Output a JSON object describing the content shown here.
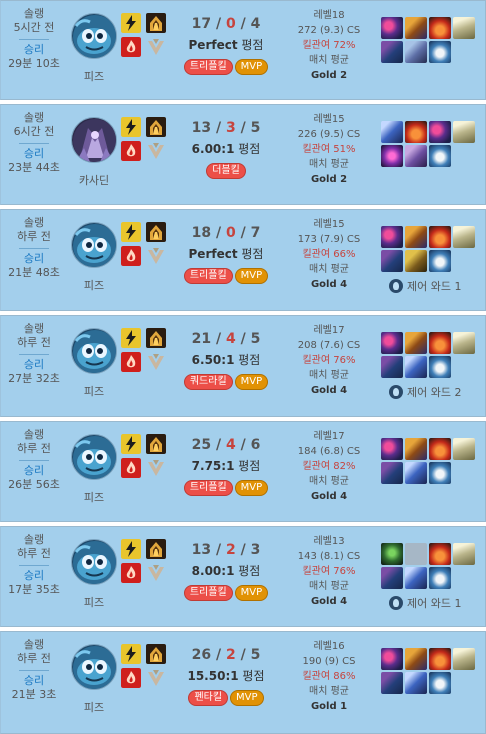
{
  "games": [
    {
      "queue": "솔랭",
      "ago": "5시간 전",
      "result": "승리",
      "duration": "29분 10초",
      "champion": "피즈",
      "champ_style": "fizz",
      "spells": [
        "flash",
        "ignite"
      ],
      "runes": [
        "precision",
        "sorcery"
      ],
      "kills": "17",
      "deaths": "0",
      "assists": "4",
      "ratio": "Perfect",
      "ratio_suffix": " 평점",
      "badges": [
        {
          "label": "트리플킬",
          "type": "kill"
        },
        {
          "label": "MVP",
          "type": "mvp"
        }
      ],
      "level": "레벨18",
      "cs": "272 (9.3) CS",
      "kp": "킬관여 72%",
      "tier": "매치 평균",
      "gold": "Gold 2",
      "items": [
        "lich",
        "zhonya",
        "rabadon",
        "hat",
        "tome",
        "boots",
        "potion"
      ],
      "ward": ""
    },
    {
      "queue": "솔랭",
      "ago": "6시간 전",
      "result": "승리",
      "duration": "23분 44초",
      "champion": "카사딘",
      "champ_style": "kassadin",
      "spells": [
        "flash",
        "ignite"
      ],
      "runes": [
        "precision",
        "sorcery"
      ],
      "kills": "13",
      "deaths": "3",
      "assists": "5",
      "ratio": "6.00:1",
      "ratio_suffix": " 평점",
      "badges": [
        {
          "label": "더블킬",
          "type": "kill"
        }
      ],
      "level": "레벨15",
      "cs": "226 (9.5) CS",
      "kp": "킬관여 51%",
      "tier": "매치 평균",
      "gold": "Gold 2",
      "items": [
        "staff",
        "rabadon",
        "lich",
        "hat",
        "void",
        "boots2",
        "potion"
      ],
      "ward": ""
    },
    {
      "queue": "솔랭",
      "ago": "하루 전",
      "result": "승리",
      "duration": "21분 48초",
      "champion": "피즈",
      "champ_style": "fizz",
      "spells": [
        "flash",
        "ignite"
      ],
      "runes": [
        "precision",
        "sorcery"
      ],
      "kills": "18",
      "deaths": "0",
      "assists": "7",
      "ratio": "Perfect",
      "ratio_suffix": " 평점",
      "badges": [
        {
          "label": "트리플킬",
          "type": "kill"
        },
        {
          "label": "MVP",
          "type": "mvp"
        }
      ],
      "level": "레벨15",
      "cs": "173 (7.9) CS",
      "kp": "킬관여 66%",
      "tier": "매치 평균",
      "gold": "Gold 4",
      "items": [
        "lich",
        "zhonya",
        "rabadon",
        "hat",
        "tome",
        "chest",
        "potion"
      ],
      "ward": "제어 와드 1"
    },
    {
      "queue": "솔랭",
      "ago": "하루 전",
      "result": "승리",
      "duration": "27분 32초",
      "champion": "피즈",
      "champ_style": "fizz",
      "spells": [
        "flash",
        "ignite"
      ],
      "runes": [
        "precision",
        "sorcery"
      ],
      "kills": "21",
      "deaths": "4",
      "assists": "5",
      "ratio": "6.50:1",
      "ratio_suffix": " 평점",
      "badges": [
        {
          "label": "쿼드라킬",
          "type": "kill"
        },
        {
          "label": "MVP",
          "type": "mvp"
        }
      ],
      "level": "레벨17",
      "cs": "208 (7.6) CS",
      "kp": "킬관여 76%",
      "tier": "매치 평균",
      "gold": "Gold 4",
      "items": [
        "lich",
        "zhonya",
        "rabadon",
        "hat",
        "tome",
        "staff",
        "potion"
      ],
      "ward": "제어 와드 2"
    },
    {
      "queue": "솔랭",
      "ago": "하루 전",
      "result": "승리",
      "duration": "26분 56초",
      "champion": "피즈",
      "champ_style": "fizz",
      "spells": [
        "flash",
        "ignite"
      ],
      "runes": [
        "precision",
        "sorcery"
      ],
      "kills": "25",
      "deaths": "4",
      "assists": "6",
      "ratio": "7.75:1",
      "ratio_suffix": " 평점",
      "badges": [
        {
          "label": "트리플킬",
          "type": "kill"
        },
        {
          "label": "MVP",
          "type": "mvp"
        }
      ],
      "level": "레벨17",
      "cs": "184 (6.8) CS",
      "kp": "킬관여 82%",
      "tier": "매치 평균",
      "gold": "Gold 4",
      "items": [
        "lich",
        "zhonya",
        "rabadon",
        "hat",
        "tome",
        "staff",
        "potion"
      ],
      "ward": ""
    },
    {
      "queue": "솔랭",
      "ago": "하루 전",
      "result": "승리",
      "duration": "17분 35초",
      "champion": "피즈",
      "champ_style": "fizz",
      "spells": [
        "flash",
        "ignite"
      ],
      "runes": [
        "precision",
        "sorcery"
      ],
      "kills": "13",
      "deaths": "2",
      "assists": "3",
      "ratio": "8.00:1",
      "ratio_suffix": " 평점",
      "badges": [
        {
          "label": "트리플킬",
          "type": "kill"
        },
        {
          "label": "MVP",
          "type": "mvp"
        }
      ],
      "level": "레벨13",
      "cs": "143 (8.1) CS",
      "kp": "킬관여 76%",
      "tier": "매치 평균",
      "gold": "Gold 4",
      "items": [
        "dark",
        "empty",
        "rabadon",
        "hat",
        "tome",
        "staff",
        "potion"
      ],
      "ward": "제어 와드 1"
    },
    {
      "queue": "솔랭",
      "ago": "하루 전",
      "result": "승리",
      "duration": "21분 3초",
      "champion": "피즈",
      "champ_style": "fizz",
      "spells": [
        "flash",
        "ignite"
      ],
      "runes": [
        "precision",
        "sorcery"
      ],
      "kills": "26",
      "deaths": "2",
      "assists": "5",
      "ratio": "15.50:1",
      "ratio_suffix": " 평점",
      "badges": [
        {
          "label": "펜타킬",
          "type": "kill"
        },
        {
          "label": "MVP",
          "type": "mvp"
        }
      ],
      "level": "레벨16",
      "cs": "190 (9) CS",
      "kp": "킬관여 86%",
      "tier": "매치 평균",
      "gold": "Gold 1",
      "items": [
        "lich",
        "zhonya",
        "rabadon",
        "hat",
        "tome",
        "staff",
        "potion"
      ],
      "ward": ""
    }
  ],
  "colors": {
    "card_bg": "#a3cfec",
    "win_text": "#1a78c2",
    "death_text": "#c6443e",
    "kill_badge": "#ec4f48",
    "mvp_badge": "#e19205"
  },
  "icons": {
    "flash": "flash-spell-icon",
    "ignite": "ignite-spell-icon",
    "precision": "precision-rune-icon",
    "sorcery": "sorcery-rune-icon",
    "ward": "control-ward-icon"
  }
}
